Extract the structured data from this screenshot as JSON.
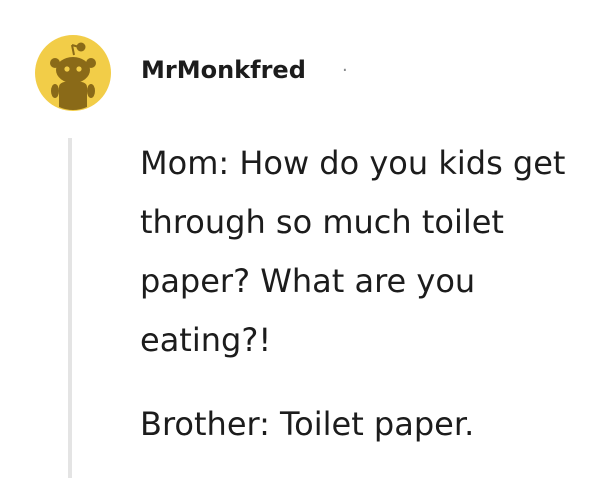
{
  "comment": {
    "author": "MrMonkfred",
    "separator": "·",
    "avatar_icon": "snoo-avatar-icon",
    "avatar_bg": "#f2cd48",
    "paragraphs": [
      "Mom: How do you kids get through so much toilet paper? What are you eating?!",
      "Brother: Toilet paper."
    ]
  }
}
